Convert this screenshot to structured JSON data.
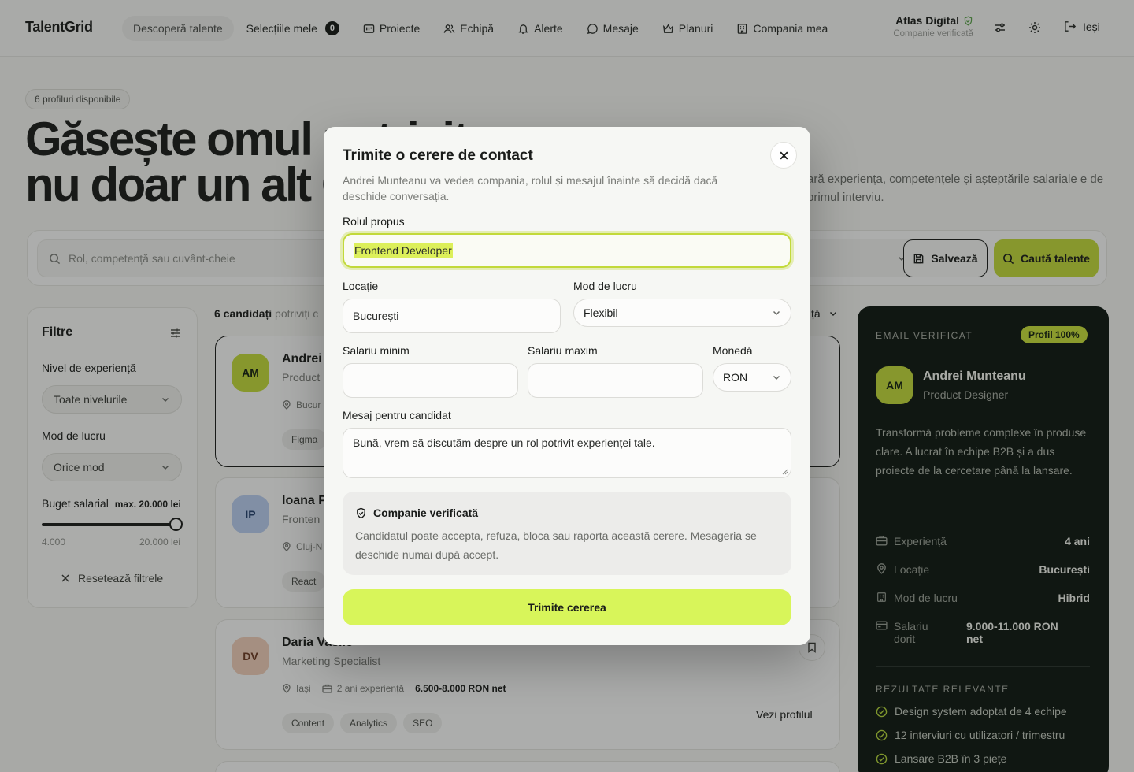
{
  "app": {
    "logo": "TalentGrid"
  },
  "nav": {
    "discover": "Descoperă talente",
    "selections": "Selecțiile mele",
    "selections_count": "0",
    "projects": "Proiecte",
    "team": "Echipă",
    "alerts": "Alerte",
    "messages": "Mesaje",
    "plans": "Planuri",
    "company": "Compania mea",
    "logout": "Ieși"
  },
  "company": {
    "name": "Atlas Digital",
    "status": "Companie verificată"
  },
  "hero": {
    "pill": "6 profiluri disponibile",
    "title_line1": "Găsește omul potrivit,",
    "title_line2": "nu doar un alt CV.",
    "desc": "ară experiența, competențele și așteptările salariale e de primul interviu."
  },
  "search": {
    "placeholder": "Rol, competență sau cuvânt-cheie",
    "save": "Salvează",
    "submit": "Caută talente"
  },
  "filters": {
    "title": "Filtre",
    "experience_label": "Nivel de experiență",
    "experience_value": "Toate nivelurile",
    "work_label": "Mod de lucru",
    "work_value": "Orice mod",
    "budget_label": "Buget salarial",
    "budget_max": "max. 20.000 lei",
    "slider_min": "4.000",
    "slider_max": "20.000 lei",
    "slider_level": 1.0,
    "reset": "Resetează filtrele"
  },
  "results": {
    "count": "6 candidați",
    "count_suffix": "potriviți c",
    "sort_suffix": "ță"
  },
  "cards": [
    {
      "initials": "AM",
      "name": "Andrei",
      "role": "Product",
      "loc": "Bucur",
      "tag": "Figma",
      "color": "#c2d93a",
      "fg": "#142010"
    },
    {
      "initials": "IP",
      "name": "Ioana P",
      "role": "Fronten",
      "loc": "Cluj-N",
      "tag": "React",
      "color": "#b9cdf0",
      "fg": "#24406e"
    },
    {
      "initials": "DV",
      "name": "Daria Vasile",
      "role": "Marketing Specialist",
      "loc": "Iași",
      "exp": "2 ani experiență",
      "salary": "6.500-8.000 RON net",
      "tags": [
        "Content",
        "Analytics",
        "SEO"
      ],
      "view": "Vezi profilul",
      "color": "#f0cdb9",
      "fg": "#6e3a24"
    }
  ],
  "panel": {
    "verified": "EMAIL VERIFICAT",
    "badge": "Profil 100%",
    "initials": "AM",
    "name": "Andrei Munteanu",
    "role": "Product Designer",
    "desc": "Transformă probleme complexe în produse clare. A lucrat în echipe B2B și a dus proiecte de la cercetare până la lansare.",
    "experience_k": "Experiență",
    "experience_v": "4 ani",
    "location_k": "Locație",
    "location_v": "București",
    "work_k": "Mod de lucru",
    "work_v": "Hibrid",
    "salary_k1": "Salariu",
    "salary_k2": "dorit",
    "salary_v1": "9.000-11.000 RON",
    "salary_v2": "net",
    "section": "REZULTATE RELEVANTE",
    "results": [
      "Design system adoptat de 4 echipe",
      "12 interviuri cu utilizatori / trimestru",
      "Lansare B2B în 3 piețe"
    ]
  },
  "modal": {
    "title": "Trimite o cerere de contact",
    "desc": "Andrei Munteanu va vedea compania, rolul și mesajul înainte să decidă dacă deschide conversația.",
    "role_label": "Rolul propus",
    "role_value": "Frontend Developer",
    "location_label": "Locație",
    "location_value": "București",
    "work_label": "Mod de lucru",
    "work_value": "Flexibil",
    "salary_min_label": "Salariu minim",
    "salary_max_label": "Salariu maxim",
    "currency_label": "Monedă",
    "currency_value": "RON",
    "message_label": "Mesaj pentru candidat",
    "message_value": "Bună, vrem să discutăm despre un rol potrivit experienței tale.",
    "info_title": "Companie verificată",
    "info_text": "Candidatul poate accepta, refuza, bloca sau raporta această cerere. Mesageria se deschide numai după accept.",
    "submit": "Trimite cererea"
  }
}
